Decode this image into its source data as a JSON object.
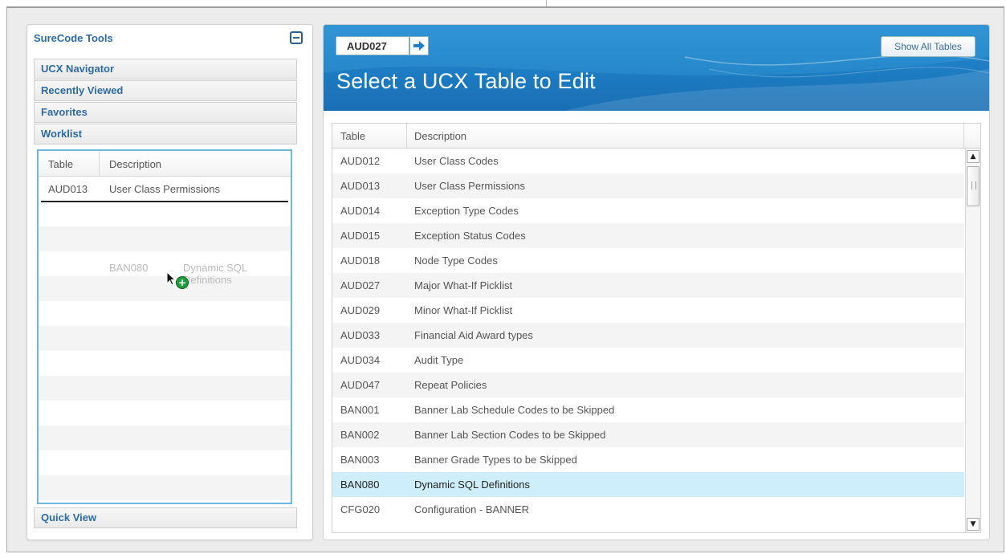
{
  "left_panel": {
    "title": "SureCode Tools",
    "sections": {
      "ucx_navigator": "UCX Navigator",
      "recently_viewed": "Recently Viewed",
      "favorites": "Favorites",
      "worklist": "Worklist",
      "quick_view": "Quick View"
    },
    "worklist": {
      "columns": [
        "Table",
        "Description"
      ],
      "rows": [
        {
          "table": "AUD013",
          "description": "User Class Permissions"
        }
      ],
      "drag_item": {
        "table": "BAN080",
        "description": "Dynamic SQL Definitions"
      }
    }
  },
  "right_panel": {
    "table_code_input": "AUD027",
    "show_all_label": "Show All Tables",
    "title": "Select a UCX Table to Edit",
    "columns": [
      "Table",
      "Description"
    ],
    "rows": [
      {
        "table": "AUD012",
        "description": "User Class Codes"
      },
      {
        "table": "AUD013",
        "description": "User Class Permissions"
      },
      {
        "table": "AUD014",
        "description": "Exception Type Codes"
      },
      {
        "table": "AUD015",
        "description": "Exception Status Codes"
      },
      {
        "table": "AUD018",
        "description": "Node Type Codes"
      },
      {
        "table": "AUD027",
        "description": "Major What-If Picklist"
      },
      {
        "table": "AUD029",
        "description": "Minor What-If Picklist"
      },
      {
        "table": "AUD033",
        "description": "Financial Aid Award types"
      },
      {
        "table": "AUD034",
        "description": "Audit Type"
      },
      {
        "table": "AUD047",
        "description": "Repeat Policies"
      },
      {
        "table": "BAN001",
        "description": "Banner Lab Schedule Codes to be Skipped"
      },
      {
        "table": "BAN002",
        "description": "Banner Lab Section Codes to be Skipped"
      },
      {
        "table": "BAN003",
        "description": "Banner Grade Types to be Skipped"
      },
      {
        "table": "BAN080",
        "description": "Dynamic SQL Definitions"
      },
      {
        "table": "CFG020",
        "description": "Configuration - BANNER"
      }
    ],
    "selected_row": "BAN080"
  },
  "colors": {
    "brand_blue": "#2c6aa0",
    "banner_blue": "#1d7cc2",
    "selected_row": "#cdeefa",
    "worklist_border": "#6fb7e0",
    "add_badge": "#1f9a3c"
  },
  "icons": {
    "collapse": "minus-box-icon",
    "go": "arrow-right-icon",
    "cursor": "mouse-pointer-icon",
    "add": "plus-circle-icon",
    "scroll_up": "triangle-up-icon",
    "scroll_down": "triangle-down-icon"
  }
}
